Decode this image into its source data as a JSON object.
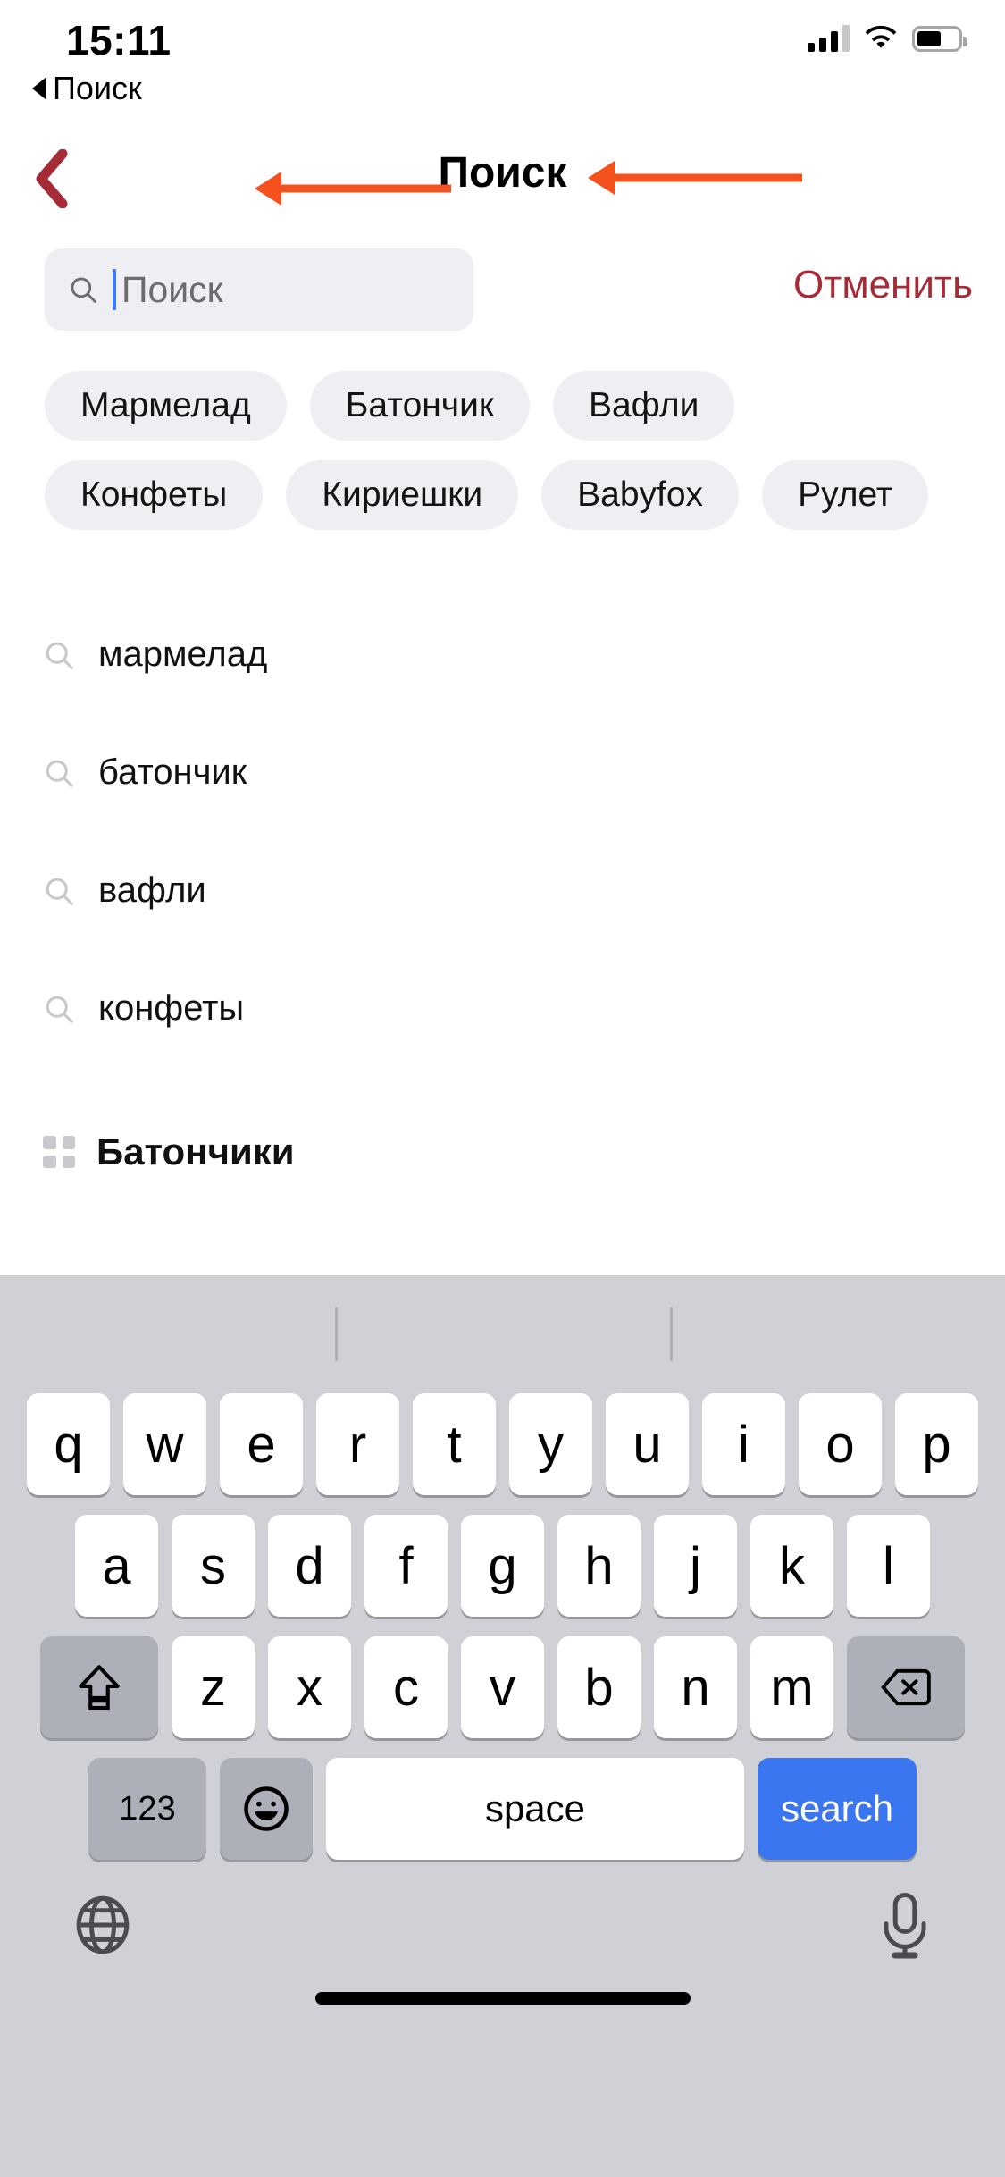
{
  "status_bar": {
    "time": "15:11",
    "back_app_label": "Поиск",
    "back_triangle_icon": "triangle-left-icon",
    "cellular_icon": "cellular-bars-icon",
    "wifi_icon": "wifi-icon",
    "battery_icon": "battery-icon"
  },
  "nav": {
    "title": "Поиск",
    "back_icon": "chevron-left-icon",
    "back_color": "#A52B37"
  },
  "annotations": {
    "color": "#F4511E",
    "title_arrow": "arrow-left-annotation",
    "search_arrow": "arrow-left-annotation"
  },
  "search": {
    "placeholder": "Поиск",
    "value": "",
    "icon": "magnifier-icon",
    "caret_color": "#3B7BF7",
    "cancel_label": "Отменить",
    "cancel_color": "#A52B37",
    "field_bg": "#EFEEF2"
  },
  "chips": {
    "row1": [
      "Мармелад",
      "Батончик",
      "Вафли"
    ],
    "row2": [
      "Конфеты",
      "Кириешки",
      "Babyfox",
      "Рулет"
    ]
  },
  "suggestions": [
    {
      "icon": "magnifier-icon",
      "text": "мармелад"
    },
    {
      "icon": "magnifier-icon",
      "text": "батончик"
    },
    {
      "icon": "magnifier-icon",
      "text": "вафли"
    },
    {
      "icon": "magnifier-icon",
      "text": "конфеты"
    }
  ],
  "category": {
    "icon": "grid-icon",
    "text": "Батончики"
  },
  "keyboard": {
    "row1": [
      "q",
      "w",
      "e",
      "r",
      "t",
      "y",
      "u",
      "i",
      "o",
      "p"
    ],
    "row2": [
      "a",
      "s",
      "d",
      "f",
      "g",
      "h",
      "j",
      "k",
      "l"
    ],
    "row3": [
      "z",
      "x",
      "c",
      "v",
      "b",
      "n",
      "m"
    ],
    "shift_icon": "shift-up-arrow-icon",
    "delete_icon": "backspace-delete-icon",
    "numbers_label": "123",
    "emoji_icon": "smiley-face-icon",
    "space_label": "space",
    "enter_label": "search",
    "enter_color": "#3A76F0",
    "globe_icon": "globe-language-icon",
    "mic_icon": "microphone-icon",
    "background": "#CFD1D6"
  }
}
